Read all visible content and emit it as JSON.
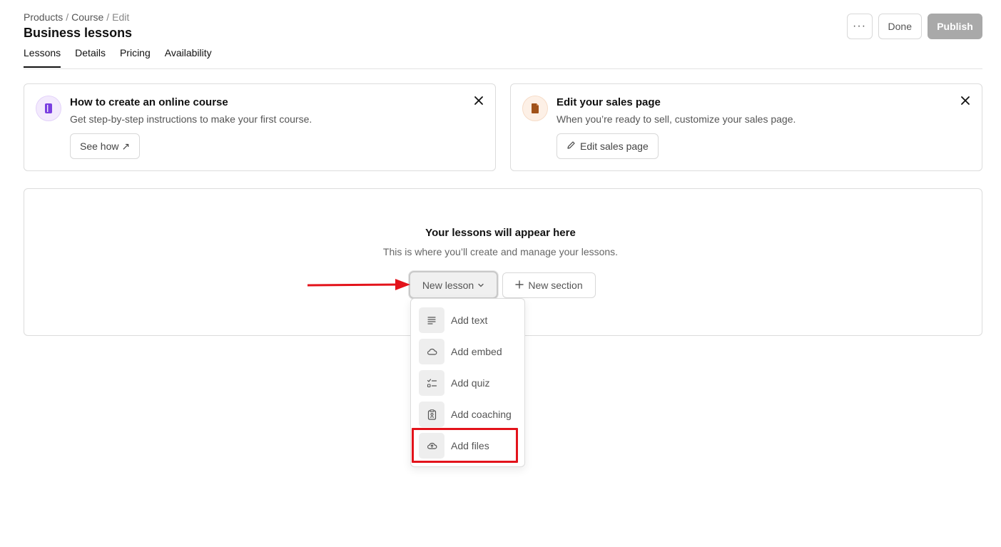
{
  "breadcrumb": {
    "products": "Products",
    "course": "Course",
    "edit": "Edit",
    "separator": "/"
  },
  "page_title": "Business lessons",
  "tabs": [
    {
      "label": "Lessons",
      "active": true
    },
    {
      "label": "Details",
      "active": false
    },
    {
      "label": "Pricing",
      "active": false
    },
    {
      "label": "Availability",
      "active": false
    }
  ],
  "actions": {
    "more": "···",
    "done": "Done",
    "publish": "Publish"
  },
  "cards": {
    "course": {
      "title": "How to create an online course",
      "description": "Get step-by-step instructions to make your first course.",
      "button": "See how ↗",
      "icon": "notebook-icon",
      "accent": "#7a3fe0"
    },
    "sales": {
      "title": "Edit your sales page",
      "description": "When you’re ready to sell, customize your sales page.",
      "button": "Edit sales page",
      "icon": "document-icon",
      "accent": "#a0521a"
    }
  },
  "empty_state": {
    "title": "Your lessons will appear here",
    "description": "This is where you’ll create and manage your lessons."
  },
  "buttons": {
    "new_lesson": "New lesson",
    "new_section": "New section"
  },
  "menu": [
    {
      "label": "Add text",
      "icon": "text-lines-icon"
    },
    {
      "label": "Add embed",
      "icon": "cloud-icon"
    },
    {
      "label": "Add quiz",
      "icon": "checklist-icon"
    },
    {
      "label": "Add coaching",
      "icon": "clipboard-user-icon"
    },
    {
      "label": "Add files",
      "icon": "upload-cloud-icon"
    }
  ],
  "annotation_colors": {
    "arrow": "#e3131b",
    "highlight": "#e3131b"
  }
}
